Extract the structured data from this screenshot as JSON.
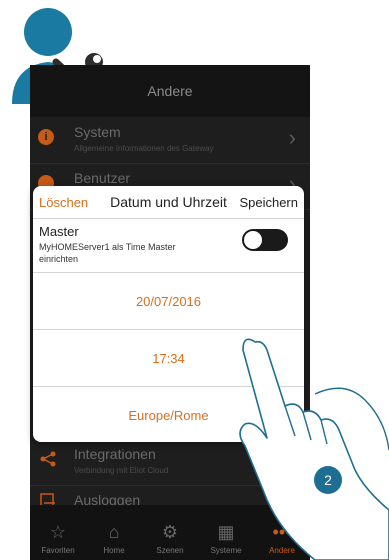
{
  "header": {
    "title": "Andere"
  },
  "menu": [
    {
      "title": "System",
      "subtitle": "Allgemeine Informationen des Gateway",
      "icon": "info-icon"
    },
    {
      "title": "Benutzer",
      "subtitle": "",
      "icon": "user-icon"
    },
    {
      "title": "Integrationen",
      "subtitle": "Verbindung mit Eliot Cloud",
      "icon": "share-icon"
    },
    {
      "title": "Ausloggen",
      "subtitle": "",
      "icon": "logout-icon"
    }
  ],
  "tabs": [
    {
      "label": "Favoriten",
      "icon": "star-icon",
      "glyph": "☆",
      "active": false
    },
    {
      "label": "Home",
      "icon": "home-icon",
      "glyph": "⌂",
      "active": false
    },
    {
      "label": "Szenen",
      "icon": "scenes-icon",
      "glyph": "⚙",
      "active": false
    },
    {
      "label": "Systeme",
      "icon": "grid-icon",
      "glyph": "▦",
      "active": false
    },
    {
      "label": "Andere",
      "icon": "more-icon",
      "glyph": "•••",
      "active": true
    }
  ],
  "dialog": {
    "cancel_label": "Löschen",
    "title": "Datum und Uhrzeit",
    "save_label": "Speichern",
    "master_label": "Master",
    "master_desc": "MyHOMEServer1 als Time Master einrichten",
    "master_toggle": false,
    "date": "20/07/2016",
    "time": "17:34",
    "timezone": "Europe/Rome"
  },
  "step_badge": "2",
  "colors": {
    "accent": "#d5701e",
    "dark_bg": "#1e1e1e",
    "badge": "#1e6e93",
    "avatar": "#1b7aa1"
  }
}
